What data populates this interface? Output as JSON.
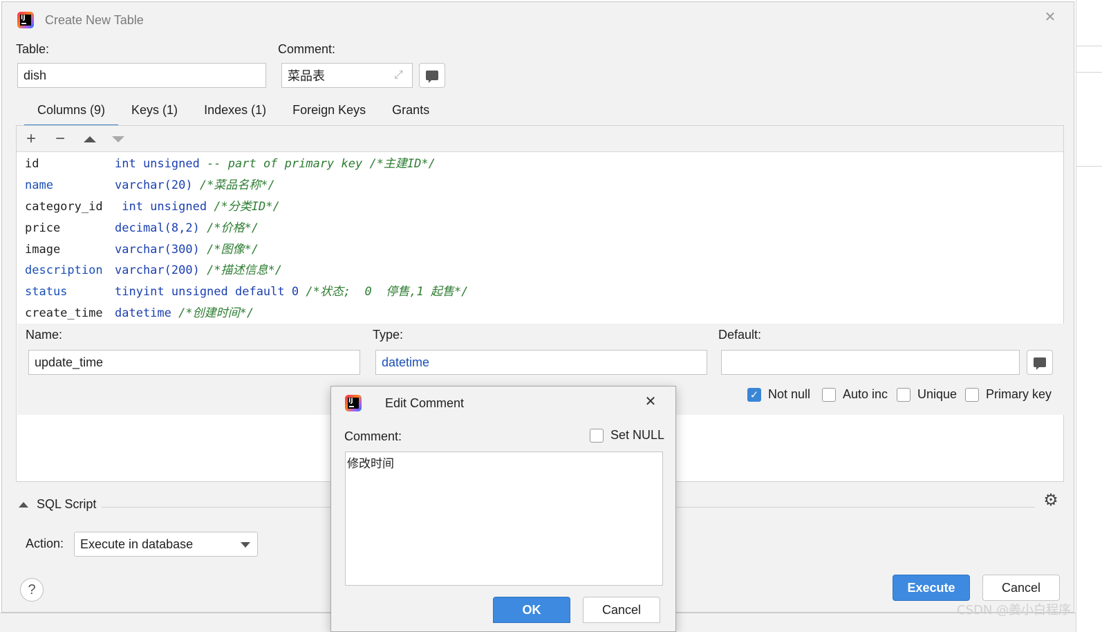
{
  "window": {
    "title": "Create New Table"
  },
  "form": {
    "table_label": "Table:",
    "table_value": "dish",
    "comment_label": "Comment:",
    "comment_value": "菜品表"
  },
  "tabs": [
    {
      "label": "Columns (9)",
      "active": true
    },
    {
      "label": "Keys (1)"
    },
    {
      "label": "Indexes (1)"
    },
    {
      "label": "Foreign Keys"
    },
    {
      "label": "Grants"
    }
  ],
  "toolbar": {
    "add": "+",
    "remove": "−"
  },
  "columns": [
    {
      "name": "id",
      "type": "int unsigned",
      "comment": " -- part of primary key /*主建ID*/"
    },
    {
      "name": "name",
      "type": "varchar(20)",
      "comment": " /*菜品名称*/"
    },
    {
      "name": "category_id",
      "type": " int unsigned",
      "comment": " /*分类ID*/"
    },
    {
      "name": "price",
      "type": "decimal(8,2)",
      "comment": " /*价格*/"
    },
    {
      "name": "image",
      "type": "varchar(300)",
      "comment": " /*图像*/"
    },
    {
      "name": "description",
      "type": "varchar(200)",
      "comment": " /*描述信息*/"
    },
    {
      "name": "status",
      "type": "tinyint unsigned default 0",
      "comment": " /*状态;  0  停售,1 起售*/"
    },
    {
      "name": "create_time",
      "type": "datetime",
      "comment": " /*创建时间*/"
    }
  ],
  "detail": {
    "name_label": "Name:",
    "name_value": "update_time",
    "type_label": "Type:",
    "type_value": "datetime",
    "default_label": "Default:",
    "default_value": "",
    "not_null": "Not null",
    "auto_inc": "Auto inc",
    "unique": "Unique",
    "primary_key": "Primary key"
  },
  "sql": {
    "label": "SQL Script"
  },
  "action": {
    "label": "Action:",
    "value": "Execute in database"
  },
  "buttons": {
    "execute": "Execute",
    "cancel": "Cancel",
    "help": "?"
  },
  "edit_comment": {
    "title": "Edit Comment",
    "comment_label": "Comment:",
    "set_null": "Set NULL",
    "text": "修改时间",
    "ok": "OK",
    "cancel": "Cancel"
  },
  "watermark": "CSDN @姜小白程序",
  "colors": {
    "accent": "#3d8ae0",
    "tab_underline": "#4083c9",
    "checkbox": "#3a86d6"
  }
}
